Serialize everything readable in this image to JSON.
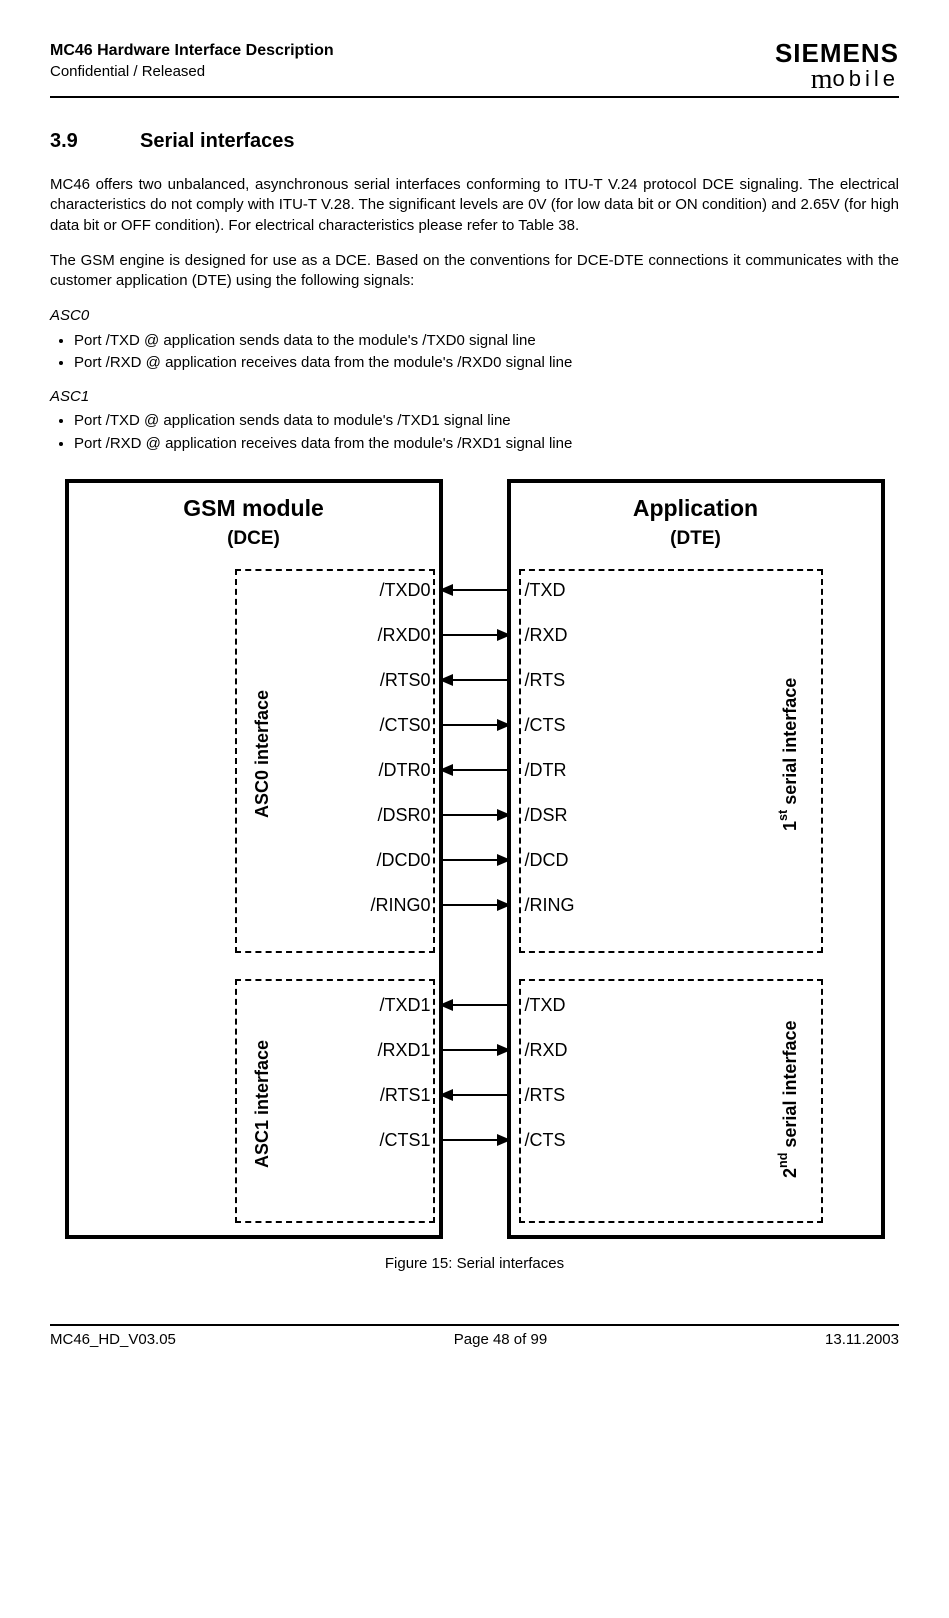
{
  "header": {
    "title": "MC46 Hardware Interface Description",
    "subtitle": "Confidential / Released",
    "logo_top": "SIEMENS",
    "logo_bottom_m": "m",
    "logo_bottom_rest": "obile"
  },
  "section": {
    "number": "3.9",
    "title": "Serial interfaces"
  },
  "para1": "MC46 offers two unbalanced, asynchronous serial interfaces conforming to ITU-T V.24 protocol DCE signaling. The electrical characteristics do not comply with ITU-T V.28. The significant levels are 0V (for low data bit or ON condition) and 2.65V (for high data bit or OFF condition). For electrical characteristics please refer to Table 38.",
  "para2": "The GSM engine is designed for use as a DCE. Based on the conventions for DCE-DTE connections it communicates with the customer application (DTE) using the following signals:",
  "asc0": {
    "heading": "ASC0",
    "items": [
      "Port /TXD @ application sends data to the module's /TXD0 signal line",
      "Port /RXD @ application receives data from the module's /RXD0 signal line"
    ]
  },
  "asc1": {
    "heading": "ASC1",
    "items": [
      "Port /TXD @ application sends data to module's /TXD1 signal line",
      "Port /RXD @ application receives data from the module's /RXD1 signal line"
    ]
  },
  "diagram": {
    "left_title": "GSM module",
    "left_sub": "(DCE)",
    "right_title": "Application",
    "right_sub": "(DTE)",
    "asc0_label": "ASC0 interface",
    "asc1_label": "ASC1 interface",
    "serial1_label_pre": "1",
    "serial1_label_sup": "st",
    "serial1_label_post": " serial interface",
    "serial2_label_pre": "2",
    "serial2_label_sup": "nd",
    "serial2_label_post": " serial interface",
    "asc0_signals": [
      {
        "l": "/TXD0",
        "r": "/TXD",
        "dir": "left"
      },
      {
        "l": "/RXD0",
        "r": "/RXD",
        "dir": "right"
      },
      {
        "l": "/RTS0",
        "r": "/RTS",
        "dir": "left"
      },
      {
        "l": "/CTS0",
        "r": "/CTS",
        "dir": "right"
      },
      {
        "l": "/DTR0",
        "r": "/DTR",
        "dir": "left"
      },
      {
        "l": "/DSR0",
        "r": "/DSR",
        "dir": "right"
      },
      {
        "l": "/DCD0",
        "r": "/DCD",
        "dir": "right"
      },
      {
        "l": "/RING0",
        "r": "/RING",
        "dir": "right"
      }
    ],
    "asc1_signals": [
      {
        "l": "/TXD1",
        "r": "/TXD",
        "dir": "left"
      },
      {
        "l": "/RXD1",
        "r": "/RXD",
        "dir": "right"
      },
      {
        "l": "/RTS1",
        "r": "/RTS",
        "dir": "left"
      },
      {
        "l": "/CTS1",
        "r": "/CTS",
        "dir": "right"
      }
    ]
  },
  "figcaption": "Figure 15: Serial interfaces",
  "footer": {
    "left": "MC46_HD_V03.05",
    "center": "Page 48 of 99",
    "right": "13.11.2003"
  }
}
